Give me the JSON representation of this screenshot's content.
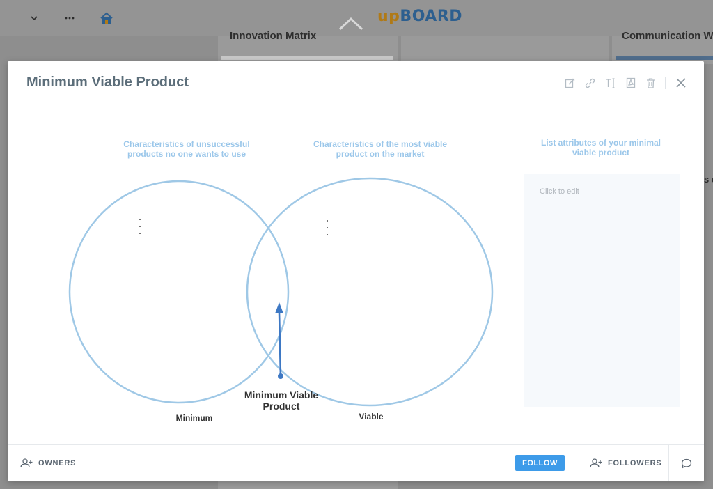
{
  "app": {
    "brand_part1": "up",
    "brand_part2": "BOARD"
  },
  "background_cards": {
    "left_title": "Innovation Matrix",
    "right_title": "Communication W",
    "right_edge_fragment": "s c"
  },
  "modal": {
    "title": "Minimum Viable Product",
    "toolbar_icons": [
      "edit-icon",
      "link-icon",
      "text-size-icon",
      "pdf-icon",
      "trash-icon",
      "close-icon"
    ]
  },
  "venn": {
    "left_caption": "Characteristics of unsuccessful products no one wants to use",
    "right_caption": "Characteristics of the most viable product on the market",
    "left_label": "Minimum",
    "right_label": "Viable",
    "center_label": "Minimum Viable Product",
    "circle_color": "#9fc8e6",
    "arrow_color": "#3d78c4"
  },
  "side_panel": {
    "heading": "List attributes of your minimal viable product",
    "placeholder": "Click to edit"
  },
  "footer": {
    "owners_label": "OWNERS",
    "follow_label": "FOLLOW",
    "followers_label": "FOLLOWERS"
  },
  "colors": {
    "accent": "#3d9be9",
    "caption": "#9bc7ea",
    "title": "#5c6e7a"
  }
}
